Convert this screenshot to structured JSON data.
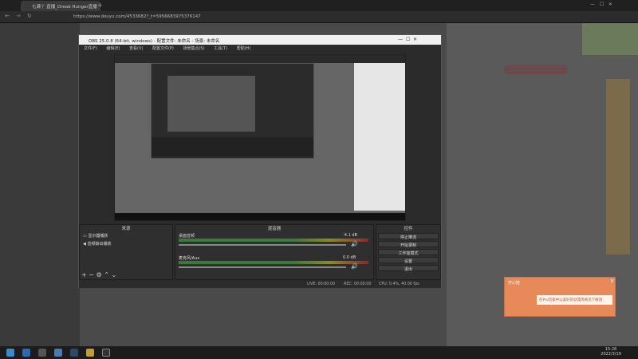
{
  "browser": {
    "tab_title": "七濑丫·直播_Dread Hunger直播",
    "url": "https://www.douyu.com/4533682?_t=5956683975376147"
  },
  "obs": {
    "title": "OBS 25.0.8 (64-bit, windows) - 配置文件: 未命名 - 场景: 未命名",
    "menu": [
      "文件(F)",
      "编辑(E)",
      "查看(V)",
      "配置文件(P)",
      "场景集合(S)",
      "工具(T)",
      "帮助(H)"
    ],
    "docks": {
      "scenes_title": "来源",
      "mixer_title": "混音器",
      "controls_title": "控件"
    },
    "sources": [
      "显示器捕获",
      "音频输出捕获"
    ],
    "mixer": [
      {
        "name": "桌面音频",
        "db": "-4.1 dB"
      },
      {
        "name": "麦克风/Aux",
        "db": "0.0 dB"
      }
    ],
    "controls": [
      "停止推流",
      "开始录制",
      "工作室模式",
      "设置",
      "退出"
    ],
    "status": {
      "live": "LIVE: 00:00:00",
      "rec": "REC: 00:00:00",
      "cpu": "CPU: 0.4%, 40.00 fps"
    }
  },
  "promo": {
    "title": "开心娃",
    "text": "在Pro玩家中以美好的动漫风格流下眼泪"
  },
  "taskbar": {
    "time": "15:28",
    "date": "2022/3/19"
  }
}
